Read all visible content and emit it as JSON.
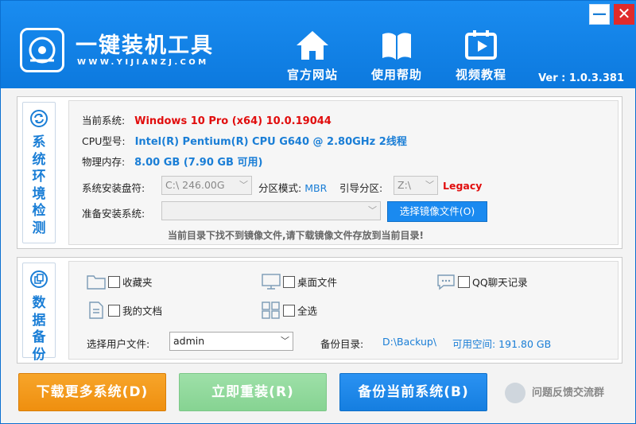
{
  "header": {
    "title": "一键装机工具",
    "subtitle": "WWW.YIJIANZJ.COM",
    "nav": {
      "site": "官方网站",
      "help": "使用帮助",
      "video": "视频教程"
    },
    "version": "Ver : 1.0.3.381",
    "minimize": "—",
    "close": "✕"
  },
  "env": {
    "tab_label": "系统环境检测",
    "os_label": "当前系统:",
    "os_value": "Windows 10 Pro (x64) 10.0.19044",
    "cpu_label": "CPU型号:",
    "cpu_value": "Intel(R) Pentium(R) CPU G640 @ 2.80GHz  2线程",
    "mem_label": "物理内存:",
    "mem_value": "8.00 GB (7.90 GB 可用)",
    "disk_label": "系统安装盘符:",
    "disk_value": "C:\\   246.00G",
    "part_label": "分区模式:",
    "part_value": "MBR",
    "boot_label": "引导分区:",
    "boot_value": "Z:\\",
    "boot_mode": "Legacy",
    "image_label": "准备安装系统:",
    "image_value": "",
    "select_button": "选择镜像文件(O)",
    "warning": "当前目录下找不到镜像文件,请下载镜像文件存放到当前目录!"
  },
  "backup": {
    "tab_label": "数据备份",
    "items": {
      "favorites": "收藏夹",
      "desktop": "桌面文件",
      "qq": "QQ聊天记录",
      "documents": "我的文档",
      "select_all": "全选"
    },
    "user_label": "选择用户文件:",
    "user_value": "admin",
    "dir_label": "备份目录:",
    "dir_value": "D:\\Backup\\",
    "space_value": "可用空间: 191.80 GB"
  },
  "actions": {
    "download": "下载更多系统(D)",
    "reinstall": "立即重装(R)",
    "backup": "备份当前系统(B)",
    "feedback": "问题反馈交流群"
  },
  "colors": {
    "header_blue": "#1a8cf0",
    "accent_red": "#e10d0d",
    "accent_blue": "#1a7ed6",
    "download_orange": "#f7a52a",
    "reinstall_green": "#9ee0a8"
  }
}
